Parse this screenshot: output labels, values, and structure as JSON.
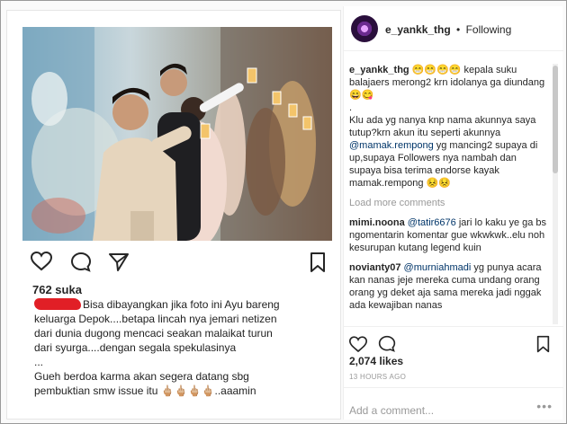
{
  "left_post": {
    "likes": "762 suka",
    "caption_lines": [
      "Bisa dibayangkan jika foto ini Ayu bareng",
      "keluarga Depok....betapa lincah nya jemari netizen",
      "dari dunia dugong mencaci seakan malaikat turun",
      "dari syurga....dengan segala spekulasinya",
      "...",
      "Gueh berdoa karma akan segera datang sbg",
      "pembuktian smw issue itu 🖕🏼🖕🏼🖕🏼🖕🏼..aaamin"
    ]
  },
  "right_panel": {
    "username": "e_yankk_thg",
    "separator": "•",
    "follow_status": "Following",
    "caption_user": "e_yankk_thg",
    "caption_parts": [
      " 😁😁😁😁 kepala suku balajaers merong2 krn idolanya ga diundang 😄😋",
      ".",
      "Klu ada yg nanya knp nama akunnya saya tutup?krn akun itu seperti akunnya ",
      "@mamak.rempong",
      " yg mancing2 supaya di up,supaya Followers nya nambah dan supaya bisa terima endorse kayak mamak.rempong 😣😣"
    ],
    "load_more": "Load more comments",
    "comments": [
      {
        "user": "mimi.noona",
        "mention": "@tatir6676",
        "text": " jari lo kaku ye ga bs ngomentarin komentar gue wkwkwk..elu noh kesurupan kutang legend kuin"
      },
      {
        "user": "novianty07",
        "mention": "@murniahmadi",
        "text": " yg punya acara kan nanas jeje mereka cuma undang orang orang yg deket aja sama mereka jadi nggak ada kewajiban nanas"
      }
    ],
    "likes": "2,074 likes",
    "time": "13 HOURS AGO",
    "add_comment_placeholder": "Add a comment...",
    "more_options": "•••"
  },
  "icons": [
    "heart-icon",
    "comment-icon",
    "share-icon",
    "bookmark-icon"
  ],
  "colors": {
    "censor_red": "#e11f26",
    "mention_blue": "#003569",
    "muted_gray": "#999999"
  }
}
